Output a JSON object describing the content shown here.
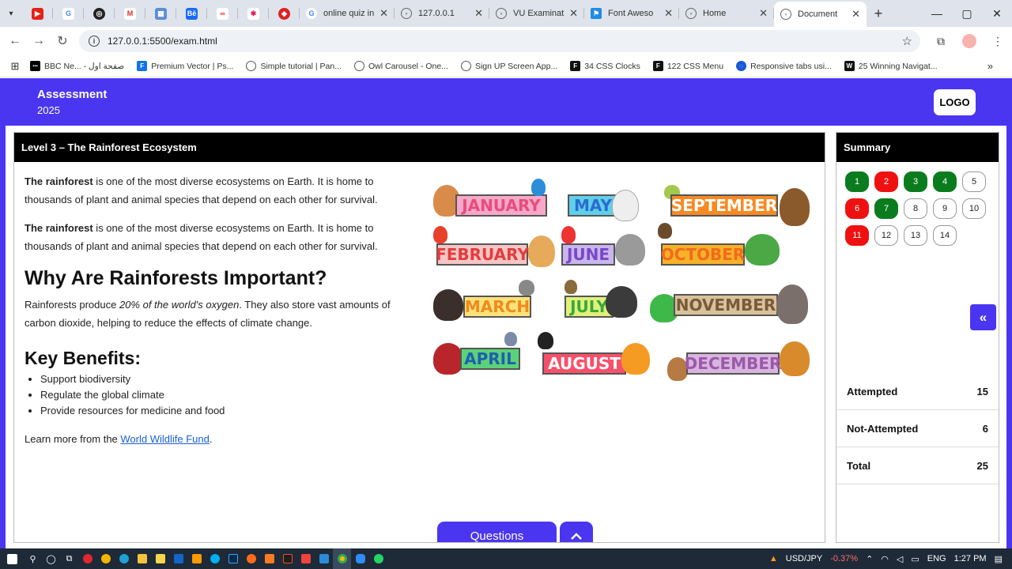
{
  "browser": {
    "tabs": [
      {
        "title": "online quiz in",
        "icon": "google-icon"
      },
      {
        "title": "127.0.0.1",
        "icon": "globe-icon"
      },
      {
        "title": "VU Examinati",
        "icon": "globe-icon"
      },
      {
        "title": "Font Aweso",
        "icon": "font-awesome-icon"
      },
      {
        "title": "Home",
        "icon": "globe-icon"
      },
      {
        "title": "Document",
        "icon": "globe-icon",
        "active": true
      }
    ],
    "url": "127.0.0.1:5500/exam.html",
    "bookmarks": [
      "BBC Ne... - صفحة اول",
      "Premium Vector | Ps...",
      "Simple tutorial | Pan...",
      "Owl Carousel - One...",
      "Sign UP Screen App...",
      "34 CSS Clocks",
      "122 CSS Menu",
      "Responsive tabs usi...",
      "25 Winning Navigat..."
    ]
  },
  "header": {
    "brand_line1": "Assessment",
    "brand_line2": "2025",
    "logo": "LOGO"
  },
  "question_panel": {
    "title": "Level 3 – The Rainforest Ecosystem",
    "para1_bold": "The rainforest",
    "para1_rest": " is one of the most diverse ecosystems on Earth. It is home to thousands of plant and animal species that depend on each other for survival.",
    "para2_bold": "The rainforest",
    "para2_rest": " is one of the most diverse ecosystems on Earth. It is home to thousands of plant and animal species that depend on each other for survival.",
    "heading1": "Why Are Rainforests Important?",
    "para3_start": "Rainforests produce ",
    "para3_em": "20% of the world's oxygen",
    "para3_end": ". They also store vast amounts of carbon dioxide, helping to reduce the effects of climate change.",
    "heading2": "Key Benefits:",
    "benefits": [
      "Support biodiversity",
      "Regulate the global climate",
      "Provide resources for medicine and food"
    ],
    "learn_prefix": "Learn more from the ",
    "learn_link": "World Wildlife Fund",
    "learn_suffix": ".",
    "months": [
      "JANUARY",
      "MAY",
      "SEPTEMBER",
      "FEBRUARY",
      "JUNE",
      "OCTOBER",
      "MARCH",
      "JULY",
      "NOVEMBER",
      "APRIL",
      "AUGUST",
      "DECEMBER"
    ]
  },
  "bottom": {
    "questions_label": "Questions",
    "up_icon": "chevron-up-icon"
  },
  "summary": {
    "title": "Summary",
    "questions": [
      {
        "n": "1",
        "status": "green"
      },
      {
        "n": "2",
        "status": "red"
      },
      {
        "n": "3",
        "status": "green"
      },
      {
        "n": "4",
        "status": "green"
      },
      {
        "n": "5",
        "status": "none"
      },
      {
        "n": "6",
        "status": "red"
      },
      {
        "n": "7",
        "status": "green"
      },
      {
        "n": "8",
        "status": "none"
      },
      {
        "n": "9",
        "status": "none"
      },
      {
        "n": "10",
        "status": "none"
      },
      {
        "n": "11",
        "status": "red"
      },
      {
        "n": "12",
        "status": "none"
      },
      {
        "n": "13",
        "status": "none"
      },
      {
        "n": "14",
        "status": "none"
      }
    ],
    "collapse_icon": "double-chevron-left-icon",
    "stats": [
      {
        "label": "Attempted",
        "value": "15"
      },
      {
        "label": "Not-Attempted",
        "value": "6"
      },
      {
        "label": "Total",
        "value": "25"
      }
    ]
  },
  "taskbar": {
    "ticker": "USD/JPY",
    "ticker_change": "-0.37%",
    "lang": "ENG",
    "time": "1:27 PM"
  },
  "colors": {
    "primary": "#4a36f0",
    "answered": "#0b7c1e",
    "wrong": "#ef1111",
    "panel_header": "#000000"
  }
}
